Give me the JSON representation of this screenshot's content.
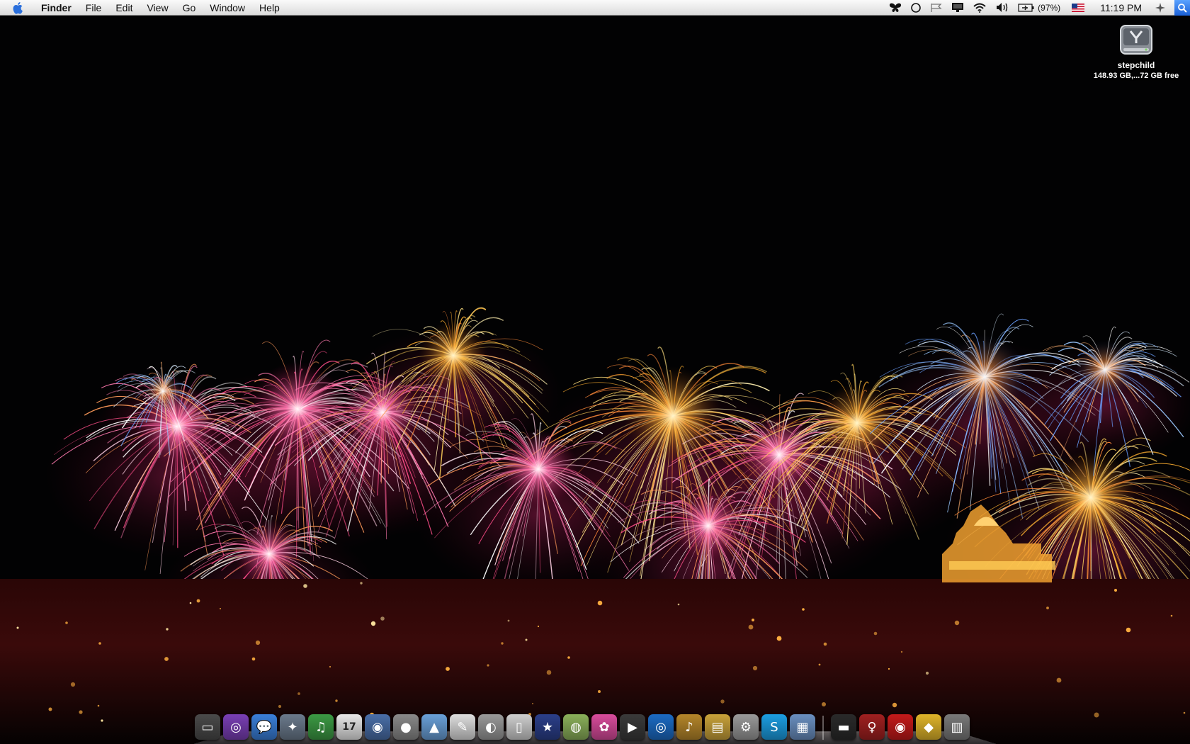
{
  "menubar": {
    "apple_icon": "apple-logo-icon",
    "app_name": "Finder",
    "menus": [
      "File",
      "Edit",
      "View",
      "Go",
      "Window",
      "Help"
    ],
    "status_icons": [
      "butterfly-icon",
      "circle-icon",
      "flag-icon",
      "display-icon",
      "wifi-icon",
      "volume-icon",
      "battery-icon"
    ],
    "battery_percent": "(97%)",
    "input_flag_icon": "us-flag-icon",
    "clock": "11:19 PM",
    "extra_icons": [
      "compass-icon",
      "spotlight-icon"
    ]
  },
  "desktop": {
    "drive": {
      "icon": "hard-drive-icon",
      "name": "stepchild",
      "info": "148.93 GB,...72 GB free"
    }
  },
  "dock": {
    "items": [
      {
        "name": "console-app",
        "glyph": "▭",
        "color": "#4a4a4a"
      },
      {
        "name": "purple-app",
        "glyph": "◎",
        "color": "#7a3fb5"
      },
      {
        "name": "ichat-app",
        "glyph": "💬",
        "color": "#3a7fd9"
      },
      {
        "name": "safari-app",
        "glyph": "✦",
        "color": "#6b7a8c"
      },
      {
        "name": "itunes-app",
        "glyph": "♫",
        "color": "#3c9a44"
      },
      {
        "name": "ical-app",
        "glyph": "17",
        "color": "#e8e8e8"
      },
      {
        "name": "iphoto-app",
        "glyph": "◉",
        "color": "#4a6fa8"
      },
      {
        "name": "mouse-app",
        "glyph": "●",
        "color": "#8a8a8a"
      },
      {
        "name": "preview-app",
        "glyph": "▲",
        "color": "#6aa0d8"
      },
      {
        "name": "textedit-app",
        "glyph": "✎",
        "color": "#dedede"
      },
      {
        "name": "disk-utility-app",
        "glyph": "◐",
        "color": "#9a9a9a"
      },
      {
        "name": "ipod-app",
        "glyph": "▯",
        "color": "#cfcfcf"
      },
      {
        "name": "star-app",
        "glyph": "★",
        "color": "#2b3f8a"
      },
      {
        "name": "globe-app",
        "glyph": "◍",
        "color": "#8bb05a"
      },
      {
        "name": "flower-app",
        "glyph": "✿",
        "color": "#d94c9c"
      },
      {
        "name": "imovie-app",
        "glyph": "▶",
        "color": "#3a3a3a"
      },
      {
        "name": "dvd-player-app",
        "glyph": "◎",
        "color": "#1c6bc4"
      },
      {
        "name": "garageband-app",
        "glyph": "♪",
        "color": "#b5862a"
      },
      {
        "name": "stickies-app",
        "glyph": "▤",
        "color": "#c9a23a"
      },
      {
        "name": "system-prefs-app",
        "glyph": "⚙",
        "color": "#9a9a9a"
      },
      {
        "name": "skype-app",
        "glyph": "S",
        "color": "#1c9ee2"
      },
      {
        "name": "finder-doc-app",
        "glyph": "▦",
        "color": "#6a8fc0"
      }
    ],
    "stack_items": [
      {
        "name": "folder-stack",
        "glyph": "▬",
        "color": "#2a2a2a"
      },
      {
        "name": "figure-stack",
        "glyph": "♀",
        "color": "#a02020"
      },
      {
        "name": "thundercats-stack",
        "glyph": "◉",
        "color": "#c41a1a"
      },
      {
        "name": "batman-stack",
        "glyph": "◆",
        "color": "#e0b52a"
      },
      {
        "name": "trash",
        "glyph": "▥",
        "color": "#7a7a7a"
      }
    ]
  }
}
